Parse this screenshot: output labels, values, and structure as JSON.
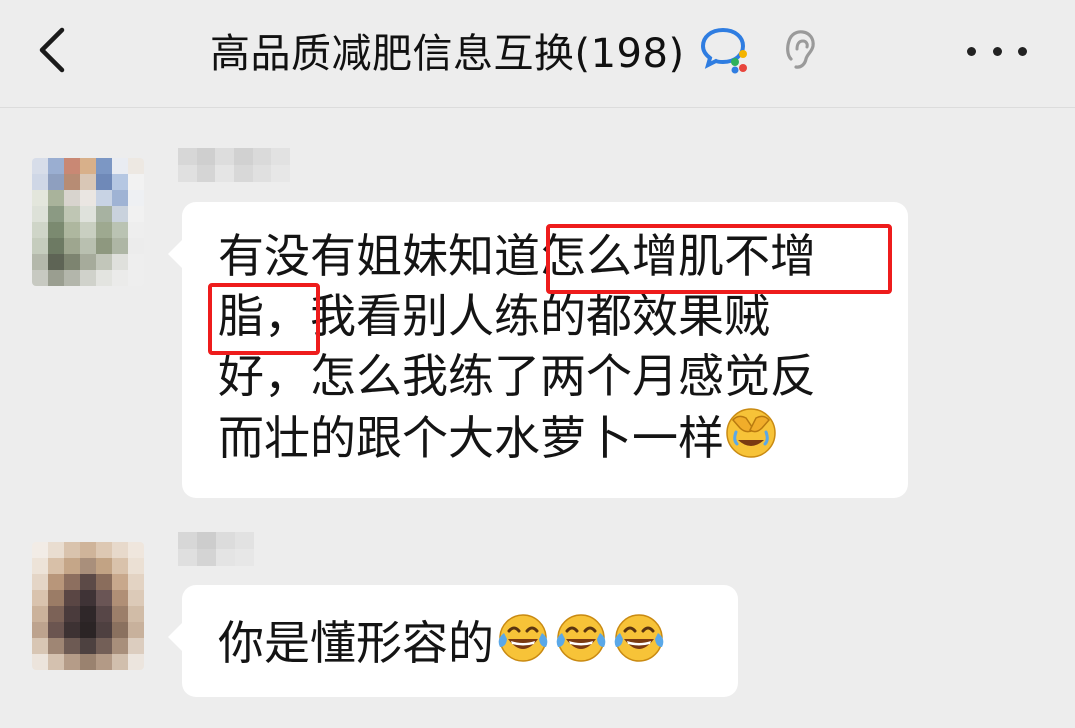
{
  "header": {
    "title": "高品质减肥信息互换(198)",
    "back_icon": "chevron-left-icon",
    "chat_badge_icon": "enterprise-chat-icon",
    "ear_icon": "muted-notification-ear-icon",
    "more_icon": "more-dots-icon"
  },
  "messages": [
    {
      "sender_blurred": true,
      "lines": [
        "有没有姐妹知道怎么增肌不增",
        "脂，我看别人练的都效果贼",
        "好，怎么我练了两个月感觉反",
        "而壮的跟个大水萝卜一样"
      ],
      "emoji": "face-palm-crying-emoji",
      "highlight_text": [
        "怎么增肌不增",
        "脂，"
      ]
    },
    {
      "sender_blurred": true,
      "text": "你是懂形容的",
      "emojis": [
        "tears-of-joy-emoji",
        "tears-of-joy-emoji",
        "tears-of-joy-emoji"
      ]
    }
  ],
  "colors": {
    "background": "#ededed",
    "bubble": "#ffffff",
    "highlight": "#ee1c1c",
    "text": "#141414"
  }
}
